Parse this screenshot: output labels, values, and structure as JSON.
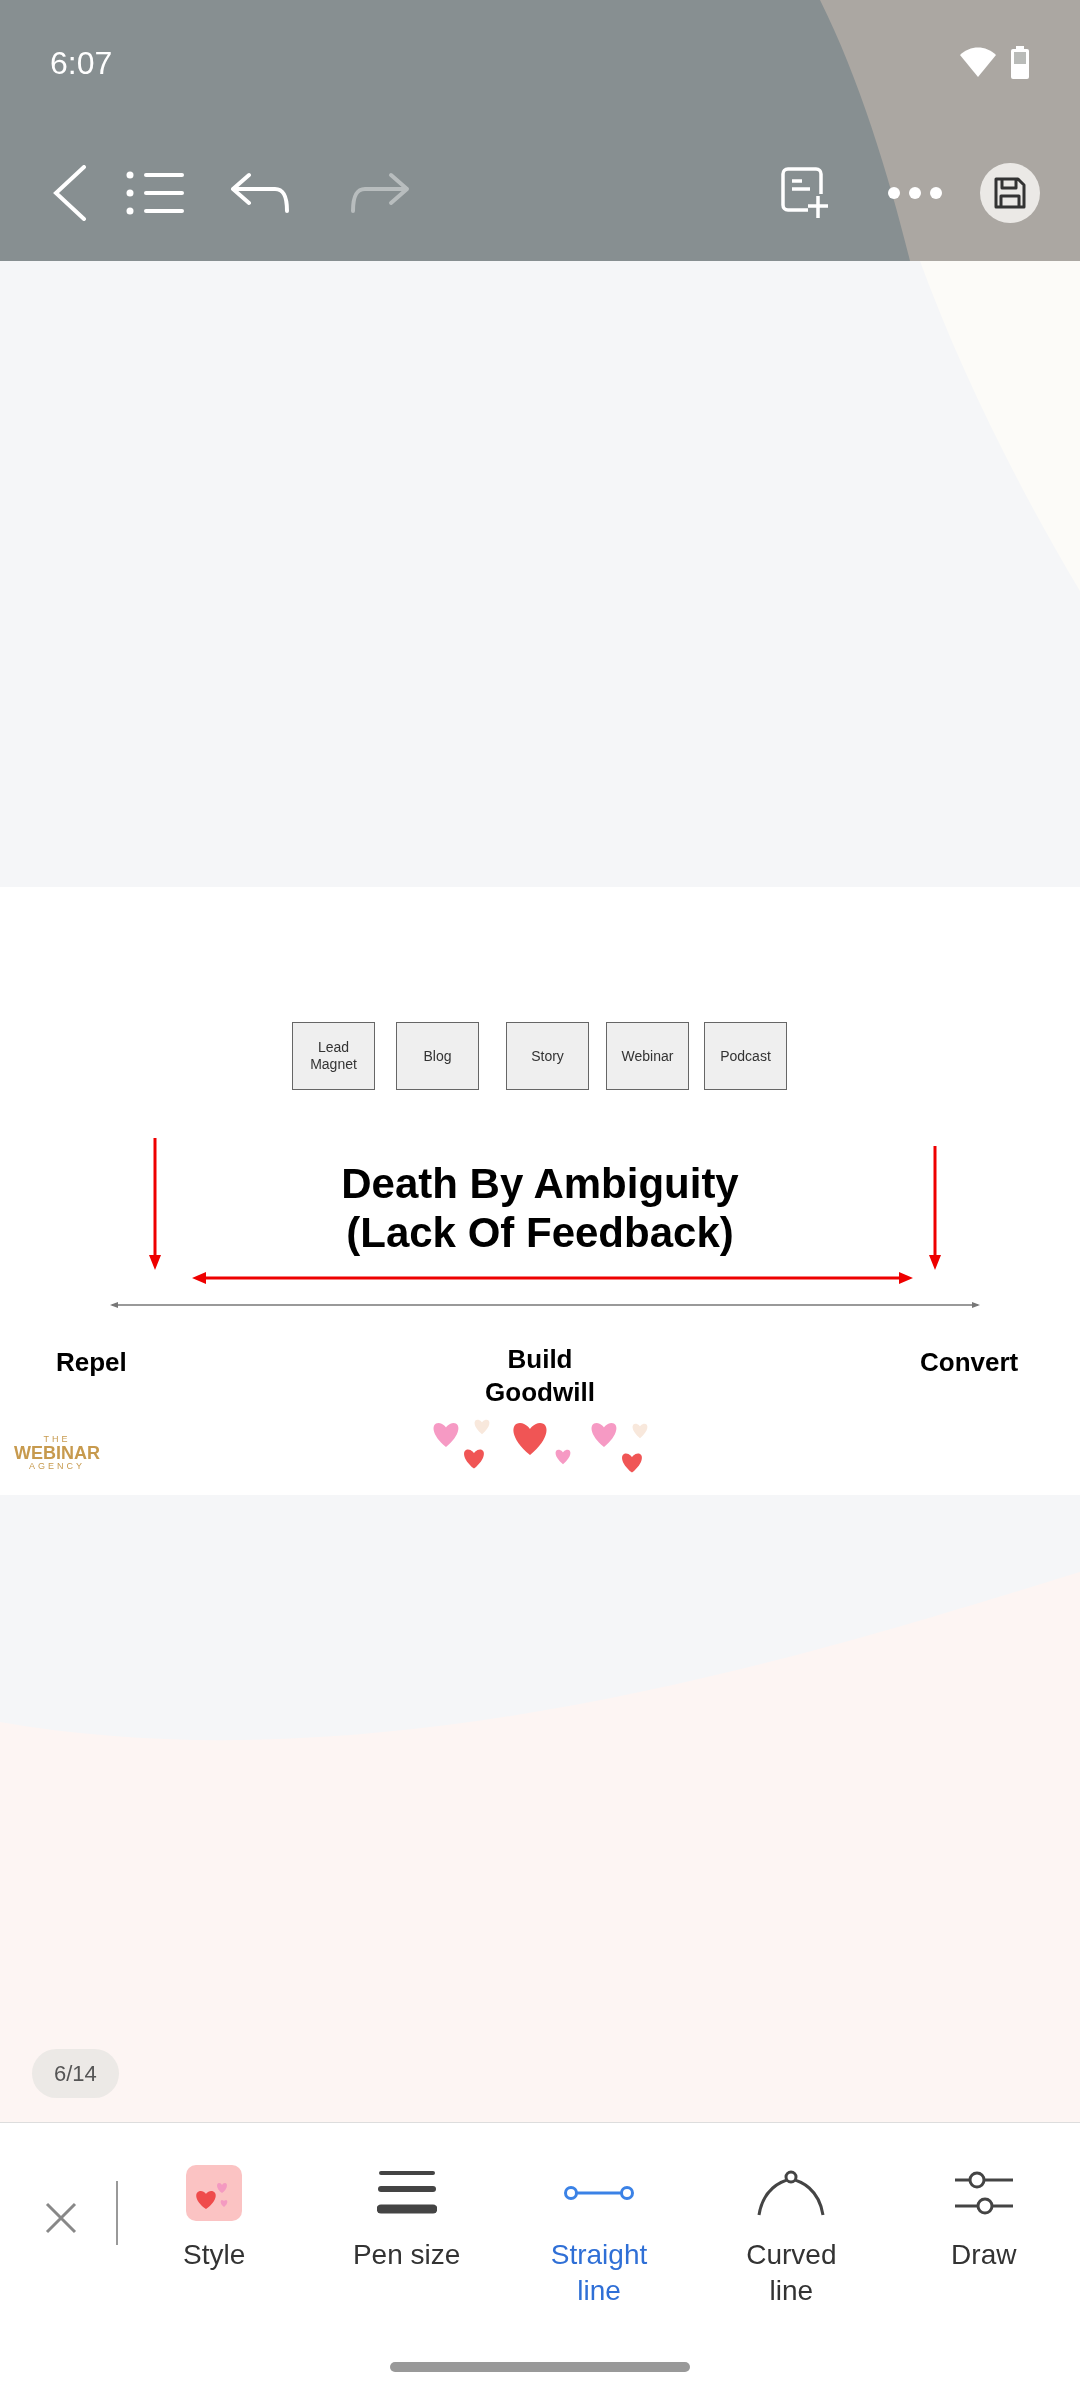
{
  "status_bar": {
    "time": "6:07"
  },
  "toolbar": {
    "redo_disabled": true
  },
  "slide": {
    "boxes": [
      "Lead\nMagnet",
      "Blog",
      "Story",
      "Webinar",
      "Podcast"
    ],
    "title": [
      "Death By Ambiguity",
      "(Lack Of Feedback)"
    ],
    "labels": [
      "Repel",
      "Build\nGoodwill",
      "Convert"
    ],
    "logo": {
      "top": "THE",
      "main": "WEBINAR",
      "bottom": "AGENCY"
    }
  },
  "page_indicator": "6/14",
  "tools": [
    {
      "kind": "style",
      "label": "Style",
      "selected": false
    },
    {
      "kind": "pen",
      "label": "Pen size",
      "selected": false
    },
    {
      "kind": "straight",
      "label": "Straight\nline",
      "selected": true
    },
    {
      "kind": "curved",
      "label": "Curved\nline",
      "selected": false
    },
    {
      "kind": "draw",
      "label": "Draw",
      "selected": false
    }
  ]
}
